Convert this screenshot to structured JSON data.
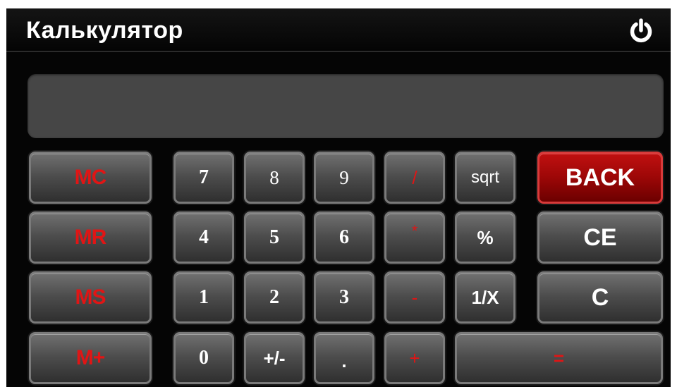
{
  "app": {
    "title": "Калькулятор",
    "power_icon": "power-icon"
  },
  "display": {
    "value": ""
  },
  "memory": {
    "mc": "MC",
    "mr": "MR",
    "ms": "MS",
    "mplus": "M+"
  },
  "keys": {
    "k7": "7",
    "k8": "8",
    "k9": "9",
    "div": "/",
    "sqrt": "sqrt",
    "back": "BACK",
    "k4": "4",
    "k5": "5",
    "k6": "6",
    "mul": "*",
    "percent": "%",
    "ce": "CE",
    "k1": "1",
    "k2": "2",
    "k3": "3",
    "sub": "-",
    "inv": "1/X",
    "c": "C",
    "k0": "0",
    "sign": "+/-",
    "dot": ".",
    "add": "+",
    "eq": "="
  },
  "colors": {
    "background": "#050505",
    "display": "#464646",
    "accent_red": "#e01515",
    "back_button": "#9c0707"
  }
}
